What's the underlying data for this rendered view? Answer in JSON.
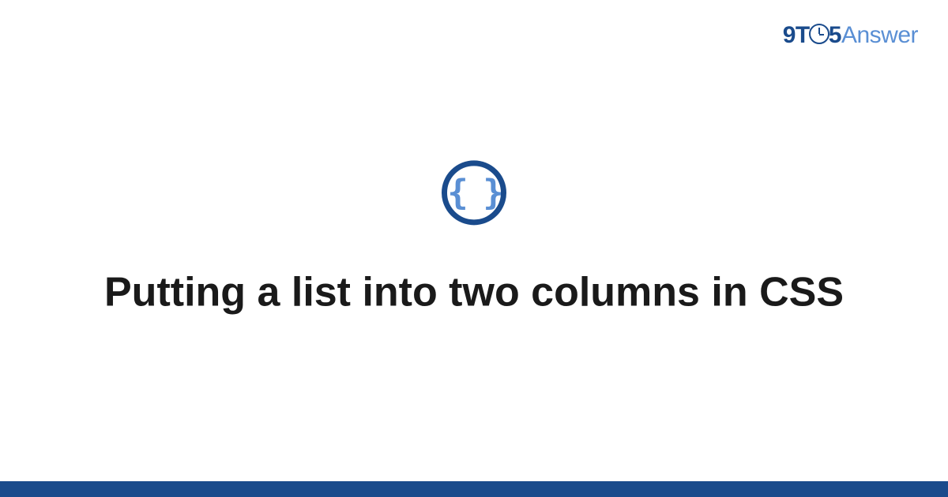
{
  "logo": {
    "part1": "9T",
    "part2": "5",
    "part3": "Answer"
  },
  "icon": {
    "name": "css-braces-icon",
    "glyph": "{ }"
  },
  "title": "Putting a list into two columns in CSS",
  "colors": {
    "primary": "#1a4b8c",
    "secondary": "#5a8fd4",
    "text": "#1a1a1a"
  }
}
